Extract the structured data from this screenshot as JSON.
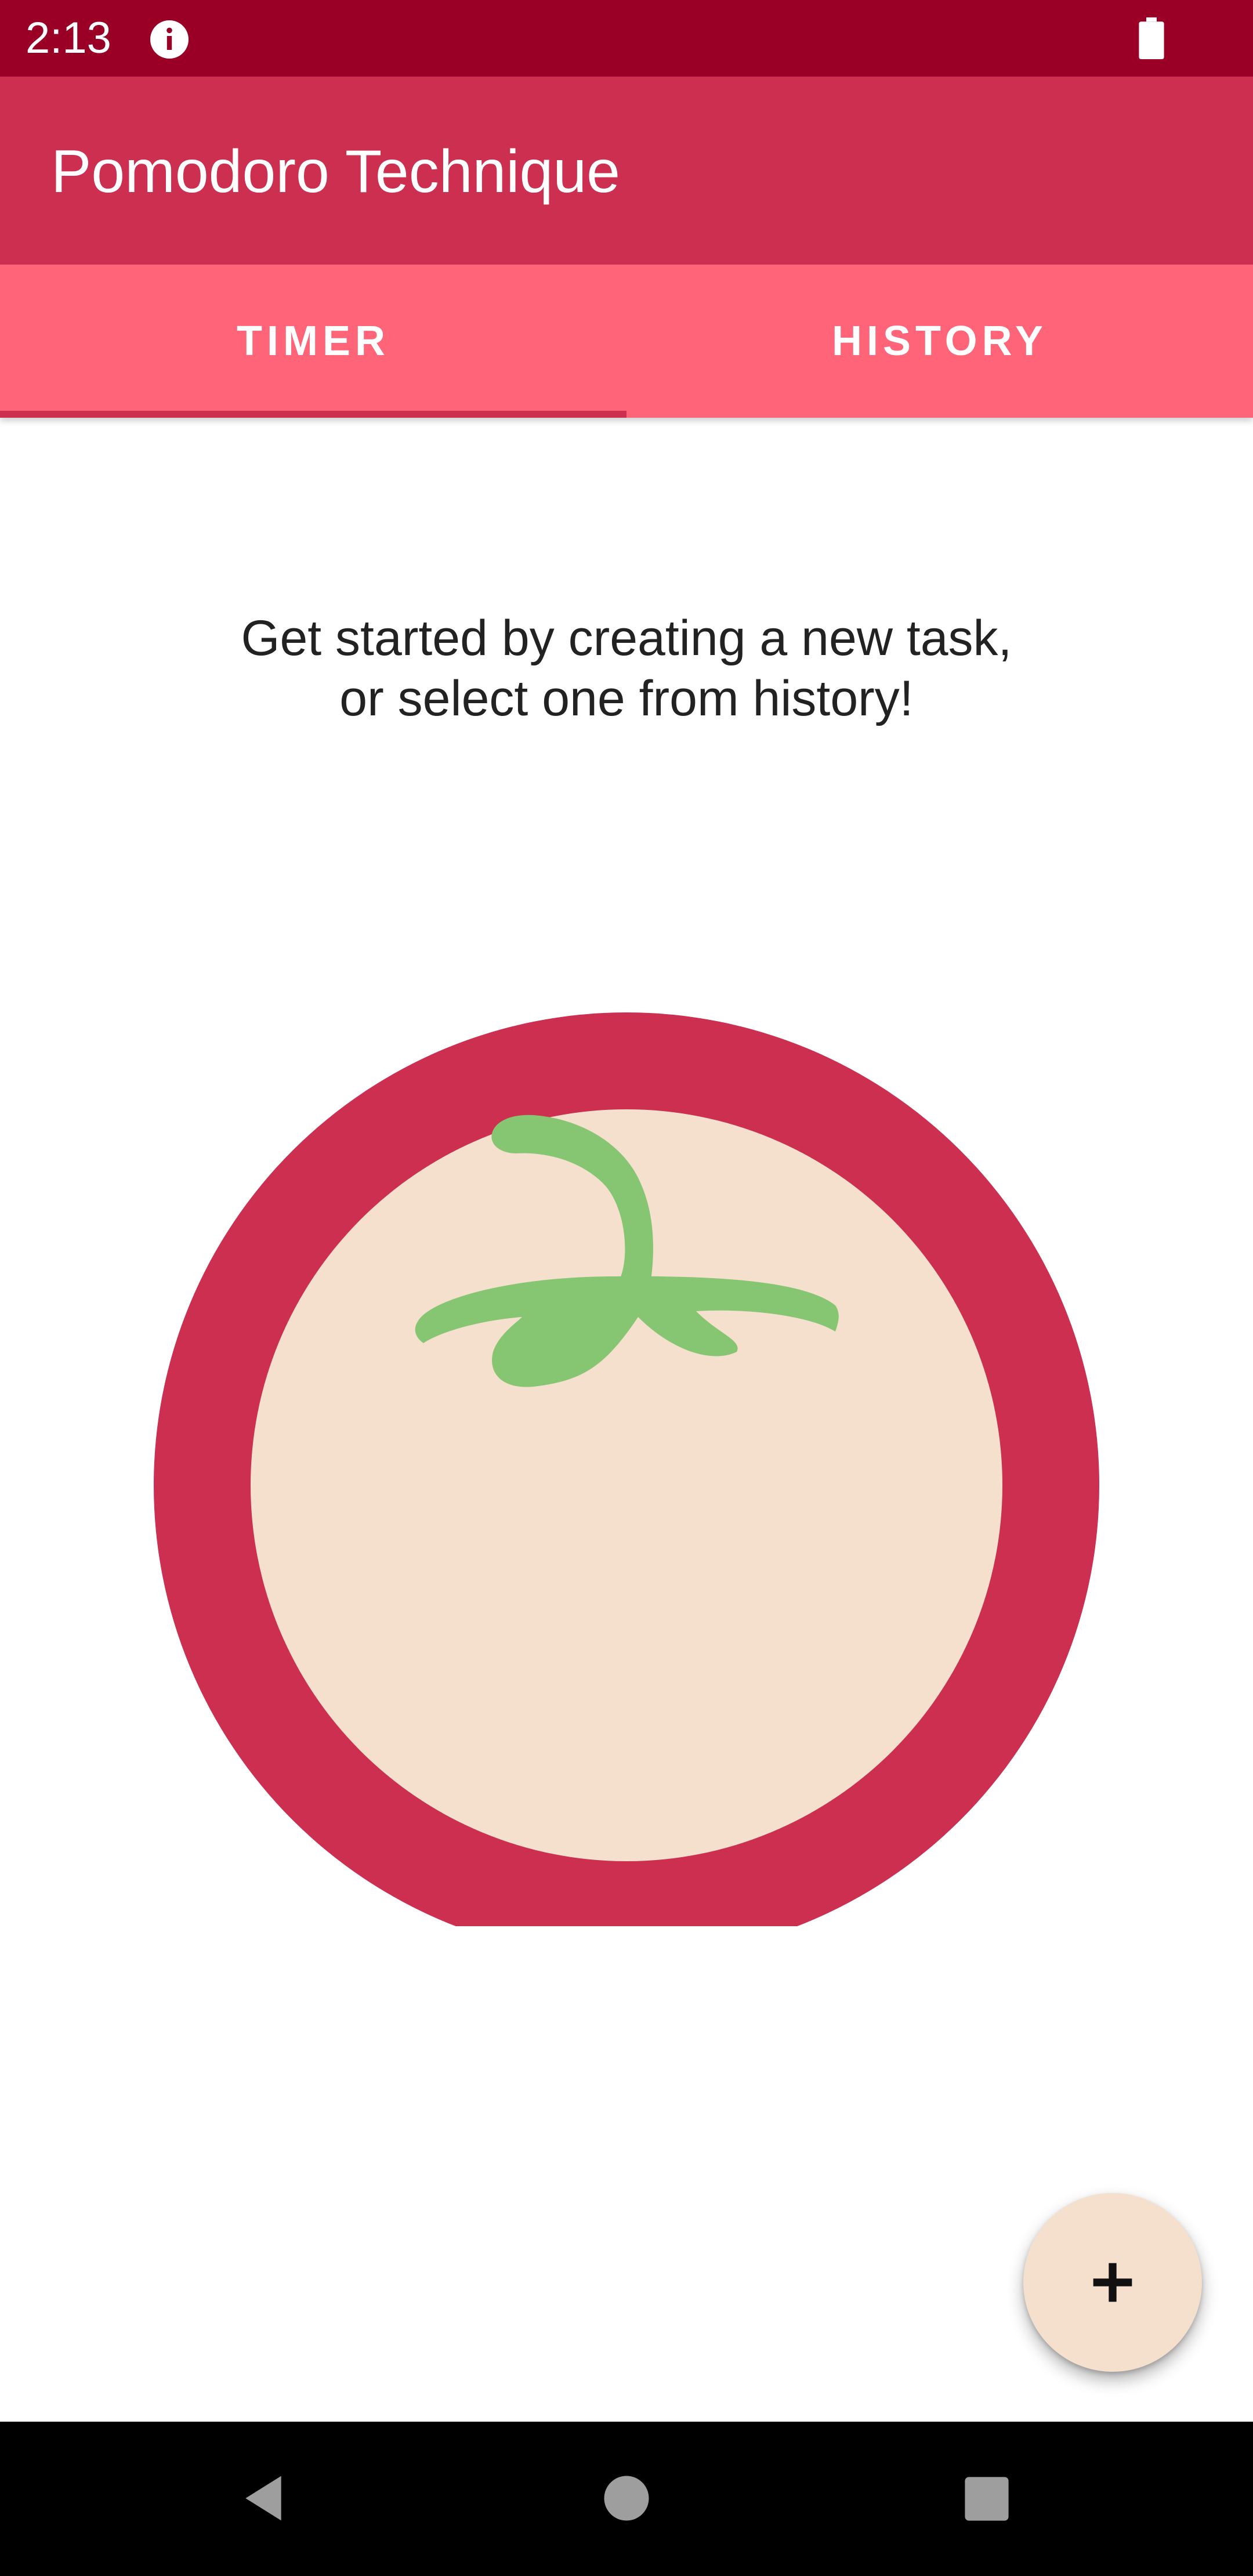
{
  "status_bar": {
    "time": "2:13",
    "icons": [
      "info-icon",
      "battery-icon"
    ]
  },
  "app_bar": {
    "title": "Pomodoro Technique"
  },
  "tabs": [
    {
      "label": "TIMER",
      "selected": true
    },
    {
      "label": "HISTORY",
      "selected": false
    }
  ],
  "main": {
    "prompt_line1": "Get started by creating a new task,",
    "prompt_line2": "or select one from history!"
  },
  "fab": {
    "icon": "plus-icon"
  },
  "nav_bar": {
    "icons": [
      "back-icon",
      "home-icon",
      "recents-icon"
    ]
  },
  "colors": {
    "status_bar": "#9a0026",
    "app_bar": "#cc2f50",
    "tabs": "#ff6478",
    "tomato_red": "#cc2f50",
    "tomato_inner": "#f5dfcd",
    "leaf_green": "#86c673",
    "fab": "#f5dfcd"
  }
}
